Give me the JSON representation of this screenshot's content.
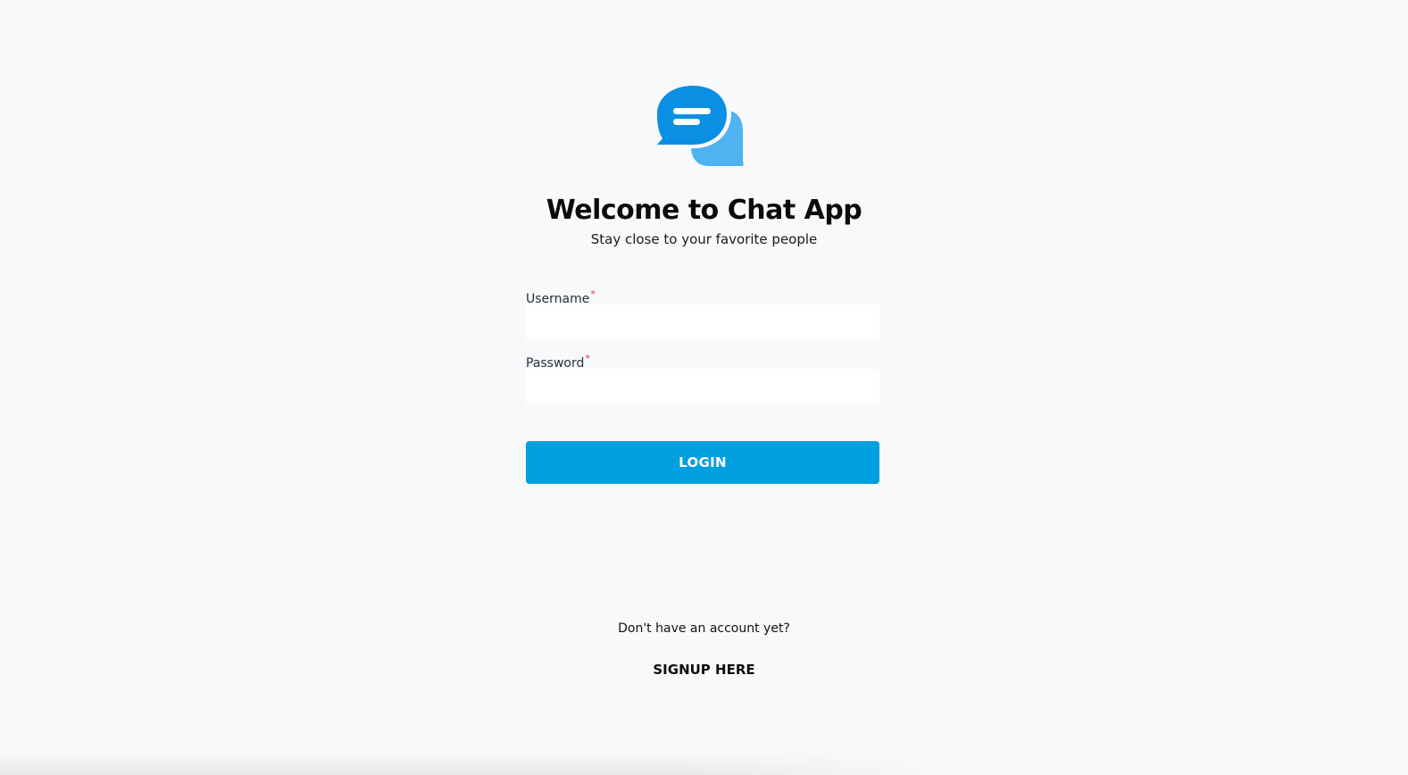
{
  "brand": {
    "logo_icon": "chat-bubbles-icon",
    "primary_color": "#0a8fe3",
    "secondary_color": "#4fb3f2"
  },
  "header": {
    "title": "Welcome to Chat App",
    "subtitle": "Stay close to your favorite people"
  },
  "form": {
    "username": {
      "label": "Username",
      "required_marker": "*",
      "value": ""
    },
    "password": {
      "label": "Password",
      "required_marker": "*",
      "value": ""
    },
    "login_label": "LOGIN",
    "login_color": "#029fe0"
  },
  "footer": {
    "prompt": "Don't have an account yet?",
    "signup_label": "SIGNUP HERE"
  }
}
